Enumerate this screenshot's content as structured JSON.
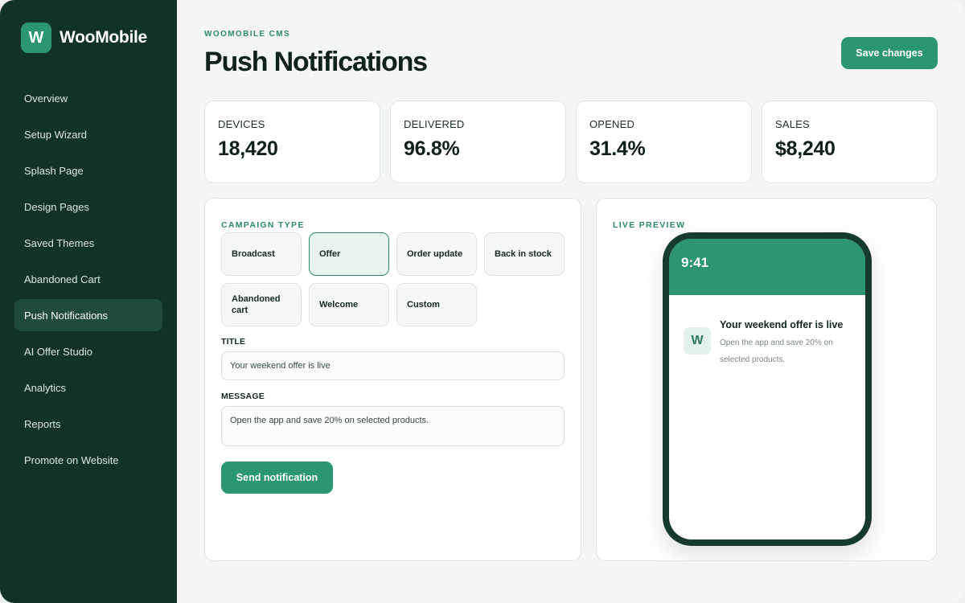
{
  "brand": {
    "logo_letter": "W",
    "name": "WooMobile"
  },
  "sidebar": {
    "items": [
      {
        "label": "Overview",
        "active": false
      },
      {
        "label": "Setup Wizard",
        "active": false
      },
      {
        "label": "Splash Page",
        "active": false
      },
      {
        "label": "Design Pages",
        "active": false
      },
      {
        "label": "Saved Themes",
        "active": false
      },
      {
        "label": "Abandoned Cart",
        "active": false
      },
      {
        "label": "Push Notifications",
        "active": true
      },
      {
        "label": "AI Offer Studio",
        "active": false
      },
      {
        "label": "Analytics",
        "active": false
      },
      {
        "label": "Reports",
        "active": false
      },
      {
        "label": "Promote on Website",
        "active": false
      }
    ]
  },
  "header": {
    "eyebrow": "WOOMOBILE CMS",
    "title": "Push Notifications",
    "save_label": "Save changes"
  },
  "stats": [
    {
      "label": "DEVICES",
      "value": "18,420"
    },
    {
      "label": "DELIVERED",
      "value": "96.8%"
    },
    {
      "label": "OPENED",
      "value": "31.4%"
    },
    {
      "label": "SALES",
      "value": "$8,240"
    }
  ],
  "campaign": {
    "section_label": "CAMPAIGN TYPE",
    "types": [
      {
        "label": "Broadcast",
        "selected": false
      },
      {
        "label": "Offer",
        "selected": true
      },
      {
        "label": "Order update",
        "selected": false
      },
      {
        "label": "Back in stock",
        "selected": false
      },
      {
        "label": "Abandoned cart",
        "selected": false
      },
      {
        "label": "Welcome",
        "selected": false
      },
      {
        "label": "Custom",
        "selected": false
      }
    ],
    "title_label": "TITLE",
    "title_value": "Your weekend offer is live",
    "message_label": "MESSAGE",
    "message_value": "Open the app and save 20% on selected products.",
    "send_label": "Send notification"
  },
  "preview": {
    "section_label": "LIVE PREVIEW",
    "time": "9:41",
    "notification": {
      "icon_letter": "W",
      "title": "Your weekend offer is live",
      "body": "Open the app and save 20% on selected products."
    }
  },
  "colors": {
    "accent": "#2c9674",
    "sidebar": "#113228",
    "sidebar_active": "#1f4a3c",
    "background": "#f3f6f4",
    "phone_frame": "#163a2f"
  }
}
